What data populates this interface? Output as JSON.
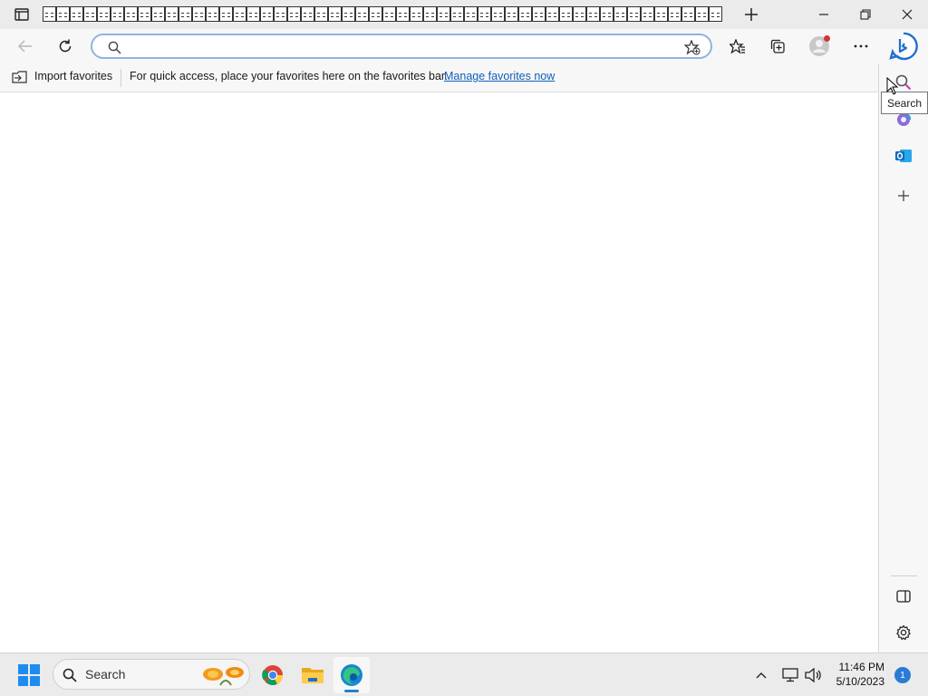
{
  "browser": {
    "tab_count_visible": 50,
    "address_bar": {
      "value": "",
      "placeholder": ""
    }
  },
  "favorites_bar": {
    "import_label": "Import favorites",
    "message": "For quick access, place your favorites here on the favorites bar.",
    "manage_link": "Manage favorites now"
  },
  "sidebar": {
    "tooltip": "Search"
  },
  "taskbar": {
    "search_label": "Search",
    "time": "11:46 PM",
    "date": "5/10/2023",
    "notification_count": "1"
  },
  "colors": {
    "accent": "#0d5fb8",
    "edge_blue": "#1b83d4",
    "outlook_blue": "#0f6cbd"
  },
  "icons": [
    "tab-actions-icon",
    "new-tab-icon",
    "minimize-icon",
    "restore-icon",
    "close-icon",
    "back-icon",
    "refresh-icon",
    "search-icon",
    "add-favorite-icon",
    "favorites-icon",
    "collections-icon",
    "profile-icon",
    "more-icon",
    "bing-chat-icon",
    "import-favorites-icon",
    "sidebar-search-icon",
    "copilot-icon",
    "outlook-icon",
    "add-icon",
    "hide-sidebar-icon",
    "settings-icon",
    "windows-start-icon",
    "chrome-icon",
    "file-explorer-icon",
    "edge-icon",
    "chevron-up-icon",
    "network-icon",
    "volume-icon"
  ]
}
